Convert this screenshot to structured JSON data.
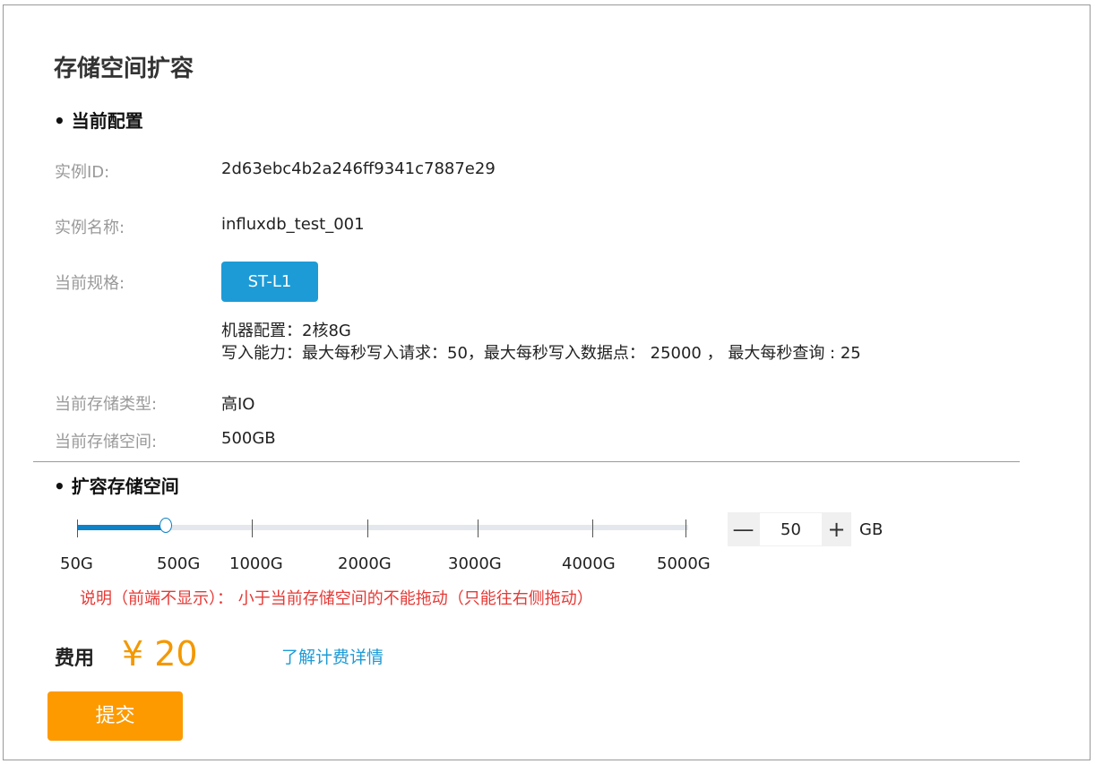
{
  "page": {
    "title": "存储空间扩容"
  },
  "current_config": {
    "section_title": "• 当前配置",
    "fields": [
      {
        "label": "实例ID:",
        "value": "2d63ebc4b2a246ff9341c7887e29"
      },
      {
        "label": "实例名称:",
        "value": "influxdb_test_001"
      },
      {
        "label": "当前规格:",
        "value": "ST-L1"
      },
      {
        "label": "当前存储类型:",
        "value": "高IO"
      },
      {
        "label": "当前存储空间:",
        "value": "500GB"
      }
    ],
    "machine_config": "机器配置：2核8G",
    "write_capacity": "写入能力：最大每秒写入请求：50，最大每秒写入数据点： 25000 ， 最大每秒查询 : 25"
  },
  "expand": {
    "section_title": "• 扩容存储空间",
    "slider": {
      "min_gb": 50,
      "max_gb": 5000,
      "selected_label": "500G",
      "tick_labels": [
        "50G",
        "500G",
        "1000G",
        "2000G",
        "3000G",
        "4000G",
        "5000G"
      ]
    },
    "stepper": {
      "minus": "—",
      "plus": "+",
      "value": "50",
      "unit": "GB"
    },
    "note": "说明（前端不显示）： 小于当前存储空间的不能拖动（只能往右侧拖动）"
  },
  "fee": {
    "label": "费用",
    "amount": "¥ 20",
    "link": "了解计费详情"
  },
  "submit": {
    "label": "提交"
  },
  "colors": {
    "accent_blue": "#1d9bd6",
    "slider_blue": "#0e82c8",
    "orange": "#f39800",
    "submit_orange": "#fd9a00",
    "note_red": "#e53935"
  }
}
